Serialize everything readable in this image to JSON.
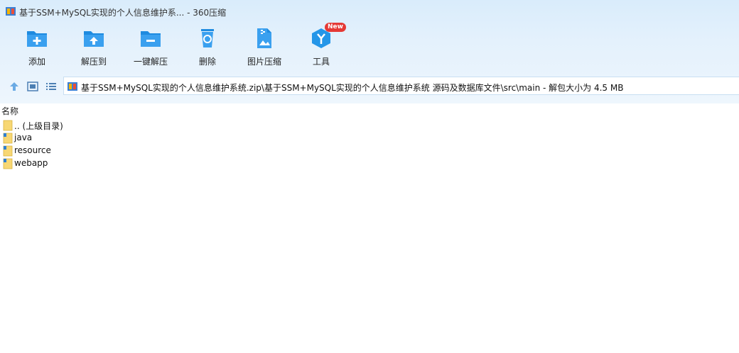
{
  "window": {
    "title": "基于SSM+MySQL实现的个人信息维护系... - 360压缩"
  },
  "toolbar": {
    "items": [
      {
        "label": "添加"
      },
      {
        "label": "解压到"
      },
      {
        "label": "一键解压"
      },
      {
        "label": "删除"
      },
      {
        "label": "图片压缩"
      },
      {
        "label": "工具",
        "badge": "New"
      }
    ]
  },
  "path": {
    "text": "基于SSM+MySQL实现的个人信息维护系统.zip\\基于SSM+MySQL实现的个人信息维护系统 源码及数据库文件\\src\\main - 解包大小为 4.5 MB"
  },
  "list": {
    "column_name": "名称",
    "items": [
      {
        "name": ".. (上级目录)"
      },
      {
        "name": "java"
      },
      {
        "name": "resource"
      },
      {
        "name": "webapp"
      }
    ]
  },
  "colors": {
    "accent": "#1e8be0",
    "badge": "#e53935",
    "folder": "#f7d774"
  }
}
